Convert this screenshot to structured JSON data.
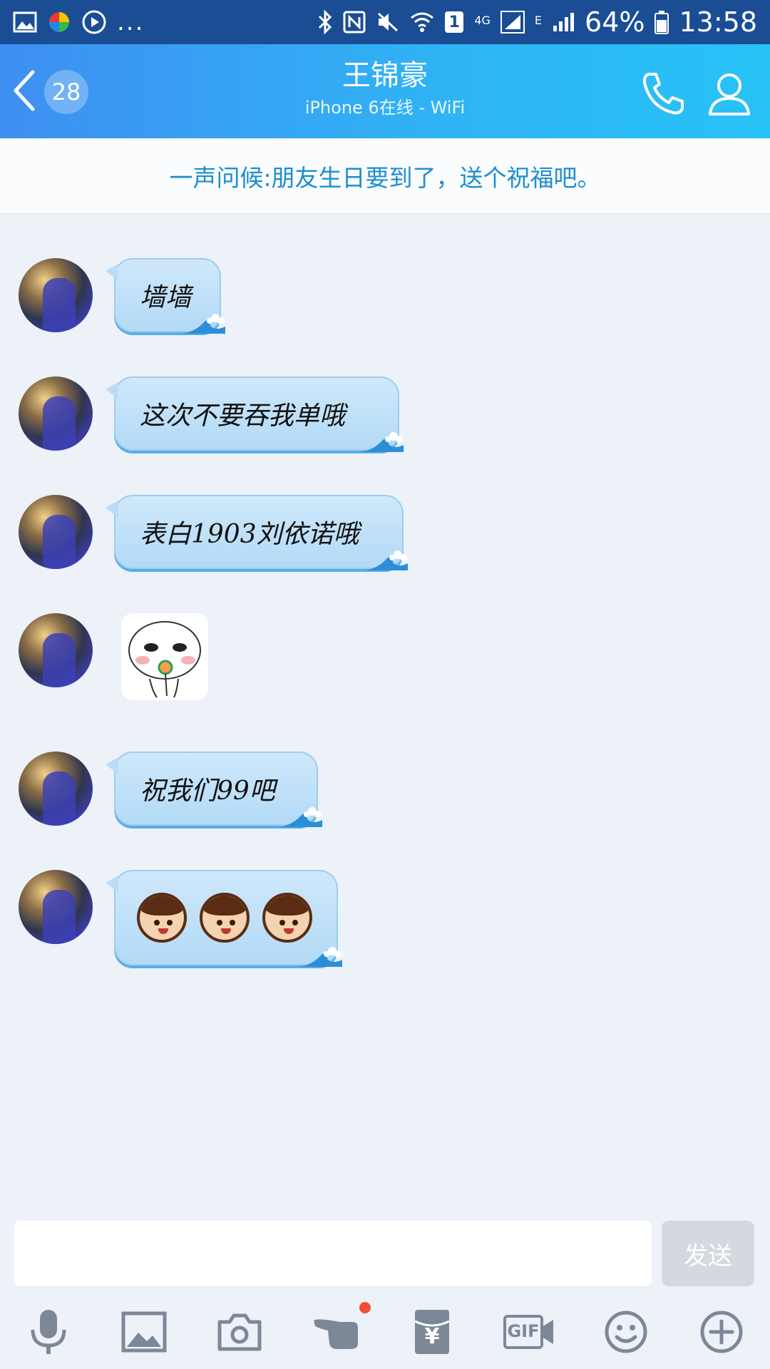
{
  "status_bar": {
    "overflow_dots": "...",
    "battery_percent": "64%",
    "time": "13:58",
    "network_type": "4G",
    "network_extra": "E",
    "sim_slot": "1"
  },
  "header": {
    "back_count": "28",
    "contact_name": "王锦豪",
    "contact_status": "iPhone 6在线 - WiFi"
  },
  "banner": {
    "text": "一声问候:朋友生日要到了，送个祝福吧。"
  },
  "messages": [
    {
      "type": "text",
      "text": "墙墙"
    },
    {
      "type": "text",
      "text": "这次不要吞我单哦"
    },
    {
      "type": "text",
      "text": "表白1903刘依诺哦"
    },
    {
      "type": "sticker",
      "icon": "white-face-sticker"
    },
    {
      "type": "text",
      "text": "祝我们99吧"
    },
    {
      "type": "emoji",
      "icons": [
        "boy-face-emoji",
        "boy-face-emoji",
        "boy-face-emoji"
      ]
    }
  ],
  "composer": {
    "input_value": "",
    "send_label": "发送"
  },
  "toolbar": {
    "items": [
      "microphone-icon",
      "image-icon",
      "camera-icon",
      "poke-hand-icon",
      "red-packet-icon",
      "gif-icon",
      "emoji-smile-icon",
      "plus-icon"
    ],
    "gif_label": "GIF",
    "currency_symbol": "¥"
  },
  "colors": {
    "status_bar": "#1a4d94",
    "header_start": "#3e8ff2",
    "header_end": "#27c2f6",
    "banner_text": "#1d8ed0",
    "background": "#edf1f8",
    "bubble": "#b3daf6",
    "badge": "#f24d3a"
  }
}
